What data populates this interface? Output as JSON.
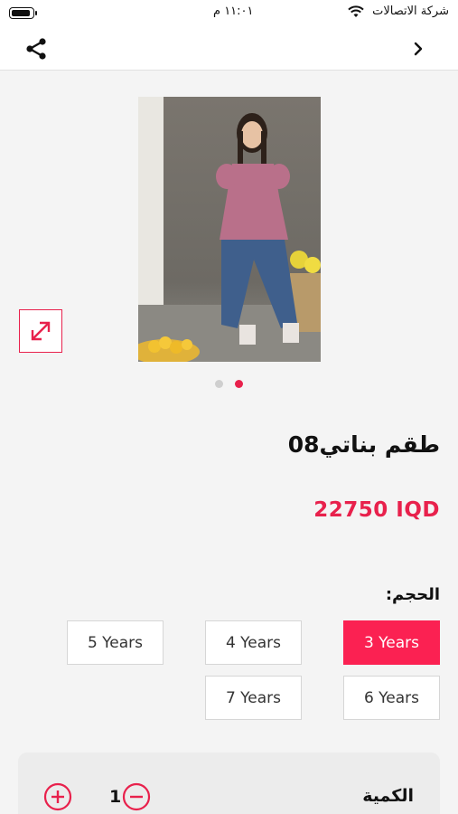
{
  "status_bar": {
    "carrier": "شركة الاتصالات",
    "time": "١١:٠١ م"
  },
  "nav": {
    "share_icon": "share-icon",
    "back_icon": "chevron-right-icon"
  },
  "gallery": {
    "image_count": 2,
    "active_index": 1,
    "expand_icon": "expand-arrows-icon"
  },
  "product": {
    "title": "طقم بناتي08",
    "price": "22750 IQD"
  },
  "sizes": {
    "label": "الحجم:",
    "options": [
      {
        "label": "3 Years",
        "selected": true
      },
      {
        "label": "4 Years",
        "selected": false
      },
      {
        "label": "5 Years",
        "selected": false
      },
      {
        "label": "6 Years",
        "selected": false
      },
      {
        "label": "7 Years",
        "selected": false
      }
    ]
  },
  "quantity": {
    "label": "الكمية",
    "value": "1"
  },
  "colors": {
    "accent": "#fb2152",
    "background": "#f4f4f4"
  }
}
